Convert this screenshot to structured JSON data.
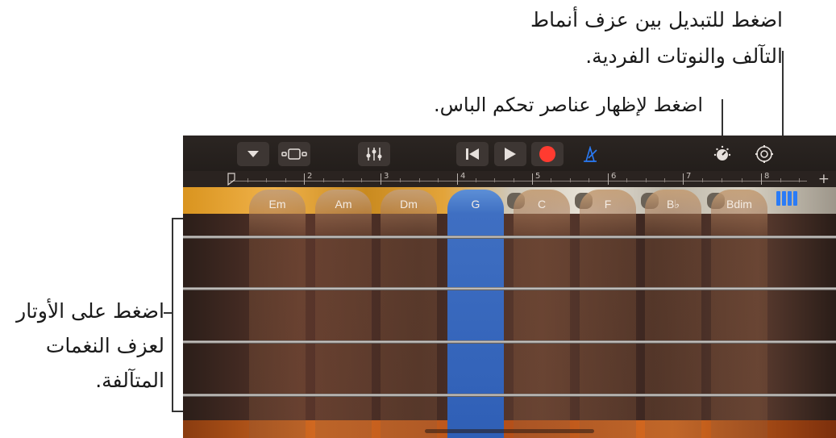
{
  "callouts": {
    "toggle_mode": {
      "line1": "اضغط للتبديل بين عزف أنماط",
      "line2": "التآلف والنوتات الفردية."
    },
    "bass_controls": "اضغط لإظهار عناصر تحكم الباس.",
    "strings": {
      "line1": "اضغط على الأوتار",
      "line2": "لعزف النغمات",
      "line3": "المتآلفة."
    }
  },
  "toolbar": {
    "icons": [
      "dropdown-icon",
      "instrument-view-icon",
      "mixer-icon",
      "rewind-icon",
      "play-icon",
      "record-icon",
      "metronome-icon",
      "bass-controls-icon",
      "settings-icon"
    ],
    "colors": {
      "record": "#ff3b30",
      "metronome": "#2a7bf6",
      "icon": "#e6e0dc"
    }
  },
  "ruler": {
    "bars": [
      "2",
      "3",
      "4",
      "5",
      "6",
      "7",
      "8"
    ],
    "add_label": "+"
  },
  "chords": [
    "Em",
    "Am",
    "Dm",
    "G",
    "C",
    "F",
    "B♭",
    "Bdim"
  ],
  "selected_chord": "G",
  "strings_count": 4,
  "mode_switch": {
    "icon": "notes-mode-icon",
    "color": "#2a7bf6"
  }
}
